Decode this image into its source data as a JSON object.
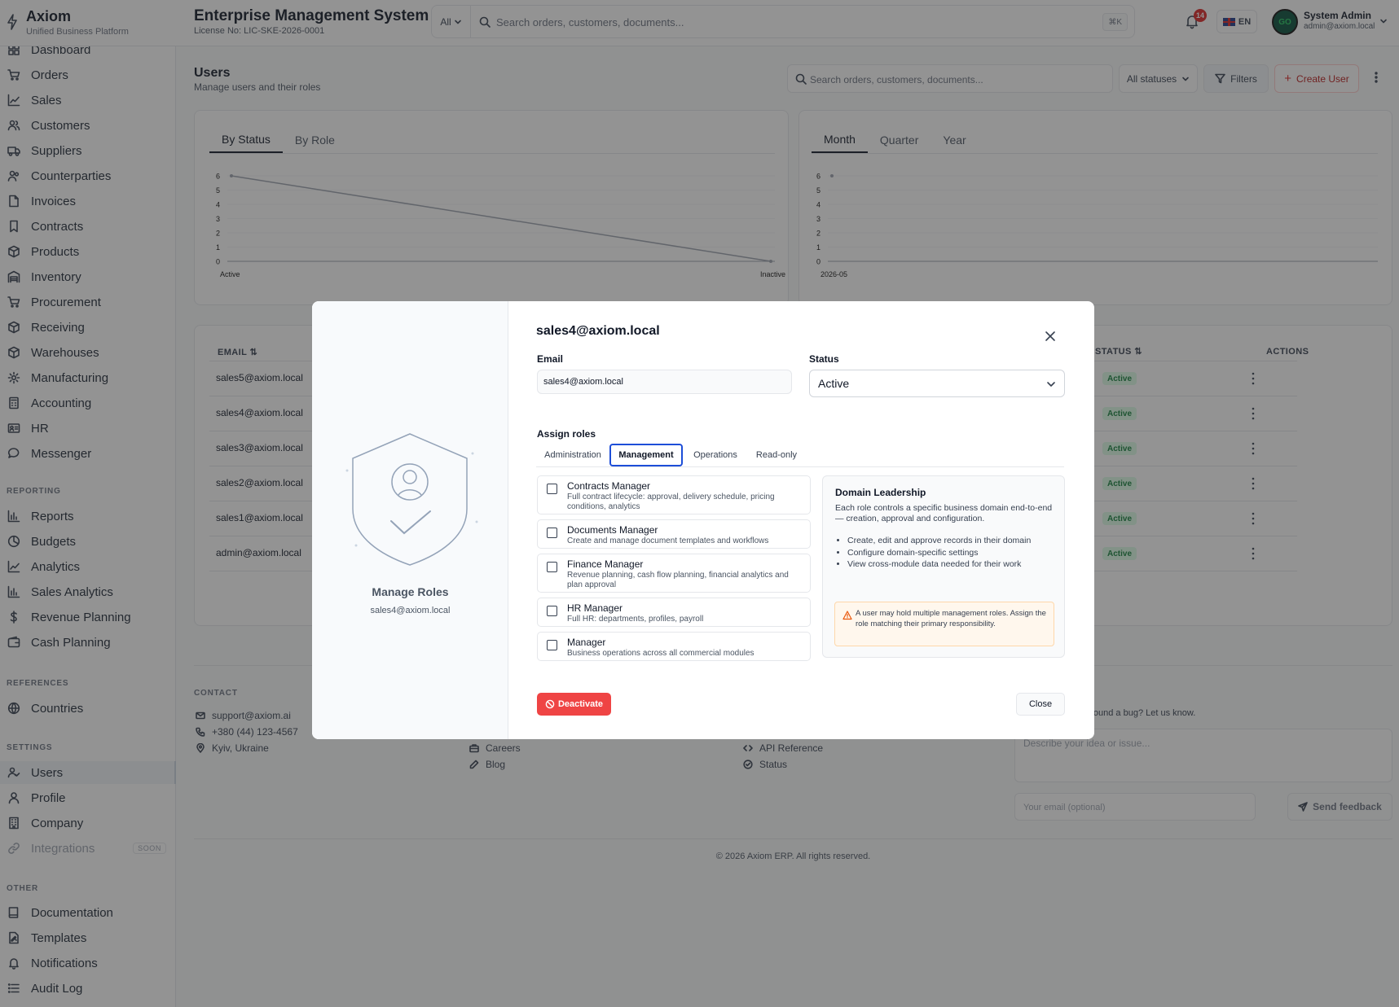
{
  "brand": {
    "name": "Axiom",
    "subtitle": "Unified Business Platform"
  },
  "topbar": {
    "title": "Enterprise Management System",
    "license": "License No: LIC-SKE-2026-0001",
    "search_scope": "All",
    "search_placeholder": "Search orders, customers, documents...",
    "shortcut": "⌘K",
    "notifications_count": "14",
    "language": "EN",
    "user_name": "System Admin",
    "user_email": "admin@axiom.local",
    "avatar_text": "GO"
  },
  "sidebar": {
    "main": [
      {
        "label": "Dashboard",
        "icon": "dashboard-icon"
      },
      {
        "label": "Orders",
        "icon": "cart-icon"
      },
      {
        "label": "Sales",
        "icon": "trend-icon"
      },
      {
        "label": "Customers",
        "icon": "users-icon"
      },
      {
        "label": "Suppliers",
        "icon": "truck-icon"
      },
      {
        "label": "Counterparties",
        "icon": "people-icon"
      },
      {
        "label": "Invoices",
        "icon": "file-icon"
      },
      {
        "label": "Contracts",
        "icon": "bookmark-icon"
      },
      {
        "label": "Products",
        "icon": "box-icon"
      },
      {
        "label": "Inventory",
        "icon": "warehouse-icon"
      },
      {
        "label": "Procurement",
        "icon": "cart-icon"
      },
      {
        "label": "Receiving",
        "icon": "box-icon"
      },
      {
        "label": "Warehouses",
        "icon": "box-icon"
      },
      {
        "label": "Manufacturing",
        "icon": "gear-icon"
      },
      {
        "label": "Accounting",
        "icon": "calculator-icon"
      },
      {
        "label": "HR",
        "icon": "id-card-icon"
      },
      {
        "label": "Messenger",
        "icon": "chat-icon"
      }
    ],
    "reporting_heading": "REPORTING",
    "reporting": [
      {
        "label": "Reports",
        "icon": "bar-chart-icon"
      },
      {
        "label": "Budgets",
        "icon": "pie-icon"
      },
      {
        "label": "Analytics",
        "icon": "trend-icon"
      },
      {
        "label": "Sales Analytics",
        "icon": "bar-chart-icon"
      },
      {
        "label": "Revenue Planning",
        "icon": "dollar-icon"
      },
      {
        "label": "Cash Planning",
        "icon": "wallet-icon"
      }
    ],
    "references_heading": "REFERENCES",
    "references": [
      {
        "label": "Countries",
        "icon": "globe-icon"
      }
    ],
    "settings_heading": "SETTINGS",
    "settings": [
      {
        "label": "Users",
        "icon": "user-check-icon",
        "active": true
      },
      {
        "label": "Profile",
        "icon": "user-icon"
      },
      {
        "label": "Company",
        "icon": "building-icon"
      },
      {
        "label": "Integrations",
        "icon": "link-icon",
        "disabled": true,
        "badge": "SOON"
      }
    ],
    "other_heading": "OTHER",
    "other": [
      {
        "label": "Documentation",
        "icon": "book-icon"
      },
      {
        "label": "Templates",
        "icon": "template-icon"
      },
      {
        "label": "Notifications",
        "icon": "bell-icon"
      },
      {
        "label": "Audit Log",
        "icon": "list-icon"
      }
    ]
  },
  "page": {
    "title": "Users",
    "subtitle": "Manage users and their roles",
    "search_placeholder": "Search orders, customers, documents...",
    "status_filter": "All statuses",
    "filters_label": "Filters",
    "create_label": "Create User"
  },
  "status_chart": {
    "tabs": [
      "By Status",
      "By Role"
    ],
    "active_tab": 0,
    "y_ticks": [
      "6",
      "5",
      "4",
      "3",
      "2",
      "1",
      "0"
    ],
    "x_labels": [
      "Active",
      "Inactive"
    ]
  },
  "period_chart": {
    "tabs": [
      "Month",
      "Quarter",
      "Year"
    ],
    "active_tab": 0,
    "y_ticks": [
      "6",
      "5",
      "4",
      "3",
      "2",
      "1",
      "0"
    ],
    "x_labels": [
      "2026-05"
    ]
  },
  "chart_data": [
    {
      "type": "line",
      "categories": [
        "Active",
        "Inactive"
      ],
      "values": [
        6,
        0
      ],
      "ylim": [
        0,
        6
      ]
    },
    {
      "type": "line",
      "categories": [
        "2026-05"
      ],
      "values": [
        6
      ],
      "ylim": [
        0,
        6
      ]
    }
  ],
  "table": {
    "col_email": "EMAIL",
    "col_status": "STATUS",
    "col_actions": "ACTIONS",
    "rows": [
      {
        "email": "sales5@axiom.local",
        "status": "Active"
      },
      {
        "email": "sales4@axiom.local",
        "status": "Active"
      },
      {
        "email": "sales3@axiom.local",
        "status": "Active"
      },
      {
        "email": "sales2@axiom.local",
        "status": "Active"
      },
      {
        "email": "sales1@axiom.local",
        "status": "Active"
      },
      {
        "email": "admin@axiom.local",
        "status": "Active"
      }
    ]
  },
  "footer": {
    "contact_heading": "CONTACT",
    "email": "support@axiom.ai",
    "phone": "+380 (44) 123-4567",
    "location": "Kyiv, Ukraine",
    "careers": "Careers",
    "blog": "Blog",
    "api_reference": "API Reference",
    "status": "Status",
    "feedback_prompt": "or found a bug? Let us know.",
    "feedback_placeholder": "Describe your idea or issue...",
    "email_placeholder": "Your email (optional)",
    "send_label": "Send feedback",
    "copyright": "© 2026 Axiom ERP. All rights reserved."
  },
  "modal": {
    "side_title": "Manage Roles",
    "side_email": "sales4@axiom.local",
    "heading": "sales4@axiom.local",
    "email_label": "Email",
    "email_value": "sales4@axiom.local",
    "status_label": "Status",
    "status_value": "Active",
    "assign_label": "Assign roles",
    "role_tabs": [
      "Administration",
      "Management",
      "Operations",
      "Read-only"
    ],
    "active_role_tab": 1,
    "roles": [
      {
        "name": "Contracts Manager",
        "desc": "Full contract lifecycle: approval, delivery schedule, pricing conditions, analytics"
      },
      {
        "name": "Documents Manager",
        "desc": "Create and manage document templates and workflows"
      },
      {
        "name": "Finance Manager",
        "desc": "Revenue planning, cash flow planning, financial analytics and plan approval"
      },
      {
        "name": "HR Manager",
        "desc": "Full HR: departments, profiles, payroll"
      },
      {
        "name": "Manager",
        "desc": "Business operations across all commercial modules"
      }
    ],
    "info_title": "Domain Leadership",
    "info_desc": "Each role controls a specific business domain end-to-end — creation, approval and configuration.",
    "info_points": [
      "Create, edit and approve records in their domain",
      "Configure domain-specific settings",
      "View cross-module data needed for their work"
    ],
    "warning": "A user may hold multiple management roles. Assign the role matching their primary responsibility.",
    "deactivate_label": "Deactivate",
    "close_label": "Close"
  },
  "colors": {
    "accent": "#1d4ed8",
    "danger": "#ef4444",
    "success_bg": "#dcfce7",
    "success_text": "#15803d"
  }
}
